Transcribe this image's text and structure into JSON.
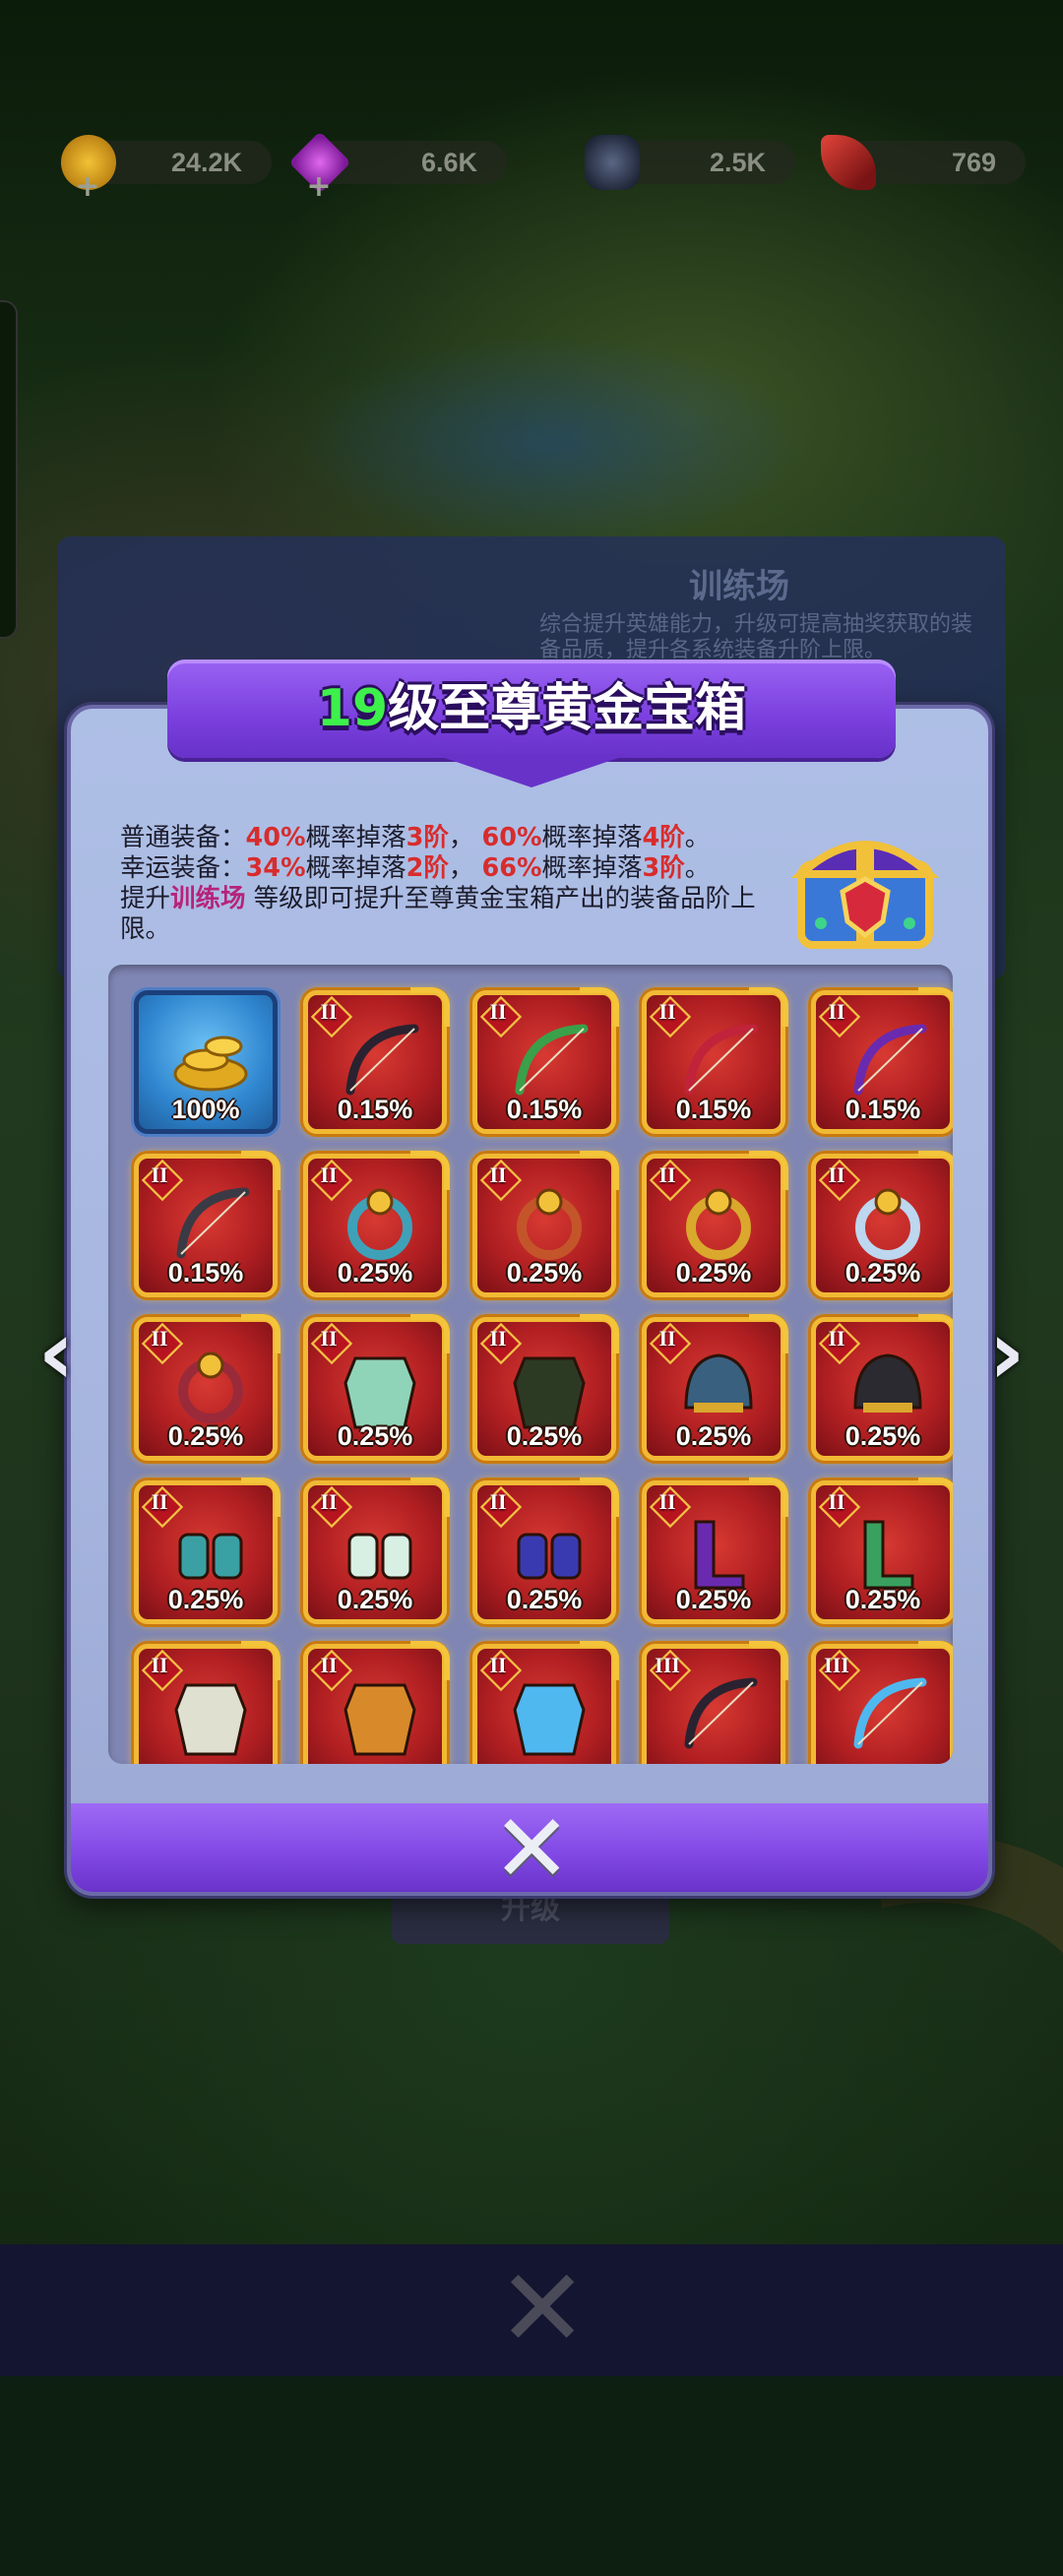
{
  "resources": [
    {
      "name": "gold",
      "value": "24.2K",
      "icon": "gold-coin-icon",
      "color": "#d8a010"
    },
    {
      "name": "gems",
      "value": "6.6K",
      "icon": "gem-icon",
      "color": "#b832c8"
    },
    {
      "name": "iron",
      "value": "2.5K",
      "icon": "iron-ore-icon",
      "color": "#34405a"
    },
    {
      "name": "feather",
      "value": "769",
      "icon": "feather-icon",
      "color": "#c8282a"
    }
  ],
  "background_panel": {
    "title": "训练场",
    "description": "综合提升英雄能力，升级可提高抽奖获取的装备品质，提升各系统装备升阶上限。",
    "button": "升级"
  },
  "dialog": {
    "title_level": "19",
    "title_text": "级至尊黄金宝箱",
    "desc": {
      "normal_prefix": "普通装备：",
      "normal_pct1": "40%",
      "normal_mid1": "概率掉落",
      "normal_tier1": "3阶",
      "normal_sep": "，",
      "normal_pct2": "60%",
      "normal_mid2": "概率掉落",
      "normal_tier2": "4阶",
      "normal_end": "。",
      "lucky_prefix": "幸运装备：",
      "lucky_pct1": "34%",
      "lucky_mid1": "概率掉落",
      "lucky_tier1": "2阶",
      "lucky_sep": "，",
      "lucky_pct2": "66%",
      "lucky_mid2": "概率掉落",
      "lucky_tier2": "3阶",
      "lucky_end": "。",
      "upgrade_prefix": "提升",
      "upgrade_link": "训练场",
      "upgrade_suffix": " 等级即可提升至尊黄金宝箱产出的装备品阶上限。"
    },
    "items": [
      {
        "tier": "",
        "pct": "100%",
        "icon": "gold-coins-icon",
        "style": "blue"
      },
      {
        "tier": "II",
        "pct": "0.15%",
        "icon": "blue-bow-icon",
        "style": "red"
      },
      {
        "tier": "II",
        "pct": "0.15%",
        "icon": "dark-bow-icon",
        "style": "red"
      },
      {
        "tier": "II",
        "pct": "0.15%",
        "icon": "green-bow-icon",
        "style": "red"
      },
      {
        "tier": "II",
        "pct": "0.15%",
        "icon": "crimson-bow-icon",
        "style": "red"
      },
      {
        "tier": "II",
        "pct": "0.15%",
        "icon": "purple-bow-icon",
        "style": "red"
      },
      {
        "tier": "II",
        "pct": "0.25%",
        "icon": "chain-necklace-icon",
        "style": "red"
      },
      {
        "tier": "II",
        "pct": "0.25%",
        "icon": "bead-necklace-icon",
        "style": "red"
      },
      {
        "tier": "II",
        "pct": "0.25%",
        "icon": "ruby-ring-icon",
        "style": "red"
      },
      {
        "tier": "II",
        "pct": "0.25%",
        "icon": "sun-ring-icon",
        "style": "red"
      },
      {
        "tier": "II",
        "pct": "0.25%",
        "icon": "diamond-ring-icon",
        "style": "red"
      },
      {
        "tier": "II",
        "pct": "0.25%",
        "icon": "red-armor-icon",
        "style": "red"
      },
      {
        "tier": "II",
        "pct": "0.25%",
        "icon": "jade-armor-icon",
        "style": "red"
      },
      {
        "tier": "II",
        "pct": "0.25%",
        "icon": "leaf-helmet-icon",
        "style": "red"
      },
      {
        "tier": "II",
        "pct": "0.25%",
        "icon": "horned-helmet-icon",
        "style": "red"
      },
      {
        "tier": "II",
        "pct": "0.25%",
        "icon": "iron-gauntlet-icon",
        "style": "red"
      },
      {
        "tier": "II",
        "pct": "0.25%",
        "icon": "fur-gauntlet-icon",
        "style": "red"
      },
      {
        "tier": "II",
        "pct": "0.25%",
        "icon": "crystal-gauntlet-icon",
        "style": "red"
      },
      {
        "tier": "II",
        "pct": "0.25%",
        "icon": "royal-boots-icon",
        "style": "red"
      },
      {
        "tier": "II",
        "pct": "0.25%",
        "icon": "winged-boots-icon",
        "style": "red"
      },
      {
        "tier": "II",
        "pct": "",
        "icon": "green-legguard-icon",
        "style": "red"
      },
      {
        "tier": "II",
        "pct": "",
        "icon": "white-legguard-icon",
        "style": "red"
      },
      {
        "tier": "II",
        "pct": "",
        "icon": "orange-legguard-icon",
        "style": "red"
      },
      {
        "tier": "III",
        "pct": "",
        "icon": "blue-bow-icon",
        "style": "red"
      },
      {
        "tier": "III",
        "pct": "",
        "icon": "dark-bow-icon",
        "style": "red"
      }
    ],
    "close_icon": "close-icon",
    "prev_icon": "chevron-left-icon",
    "next_icon": "chevron-right-icon"
  },
  "bottom_close_icon": "close-icon"
}
